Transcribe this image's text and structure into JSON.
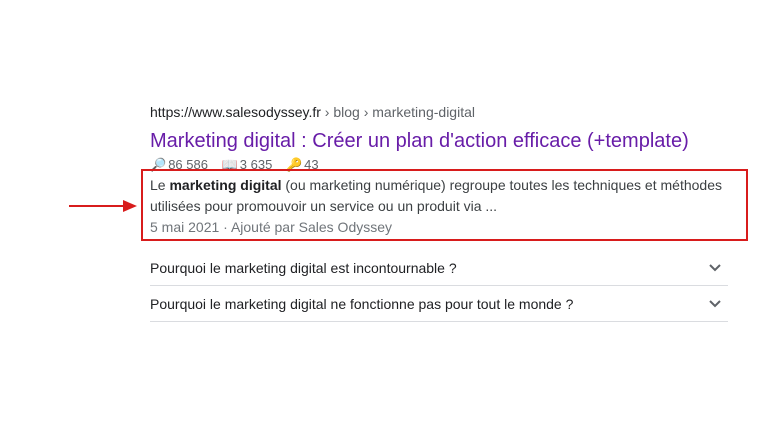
{
  "result": {
    "domain": "https://www.salesodyssey.fr",
    "path": " › blog › marketing-digital",
    "title": "Marketing digital : Créer un plan d'action efficace (+template)",
    "metrics": [
      {
        "icon": "magnifier-icon",
        "glyph": "🔎",
        "value": "86 586"
      },
      {
        "icon": "book-icon",
        "glyph": "📖",
        "value": "3 635"
      },
      {
        "icon": "key-icon",
        "glyph": "🔑",
        "value": "43"
      }
    ],
    "snippet": {
      "prefix": "Le ",
      "bold": "marketing digital",
      "rest": " (ou marketing numérique) regroupe toutes les techniques et méthodes utilisées pour promouvoir un service ou un produit via ...",
      "date_line": "5 mai 2021 · Ajouté par Sales Odyssey"
    }
  },
  "faq": [
    {
      "question": "Pourquoi le marketing digital est incontournable ?"
    },
    {
      "question": "Pourquoi le marketing digital ne fonctionne pas pour tout le monde ?"
    }
  ],
  "colors": {
    "title": "#681da8",
    "highlight": "#d81c1c"
  }
}
